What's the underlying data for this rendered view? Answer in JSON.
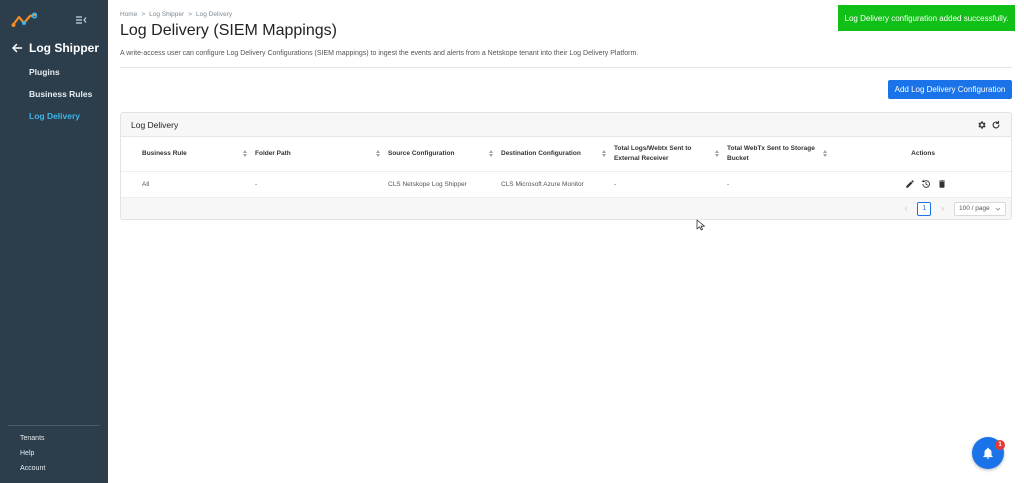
{
  "sidebar": {
    "back_title": "Log Shipper",
    "items": [
      {
        "label": "Plugins",
        "active": false
      },
      {
        "label": "Business Rules",
        "active": false
      },
      {
        "label": "Log Delivery",
        "active": true
      }
    ],
    "footer": [
      {
        "label": "Tenants"
      },
      {
        "label": "Help"
      },
      {
        "label": "Account"
      }
    ]
  },
  "breadcrumb": [
    "Home",
    "Log Shipper",
    "Log Delivery"
  ],
  "breadcrumb_separator": ">",
  "page": {
    "title": "Log Delivery (SIEM Mappings)",
    "description": "A write-access user can configure Log Delivery Configurations (SIEM mappings) to ingest the events and alerts from a Netskope tenant into their Log Delivery Platform."
  },
  "toast": {
    "message": "Log Delivery configuration added successfully."
  },
  "toolbar": {
    "add_label": "Add Log Delivery Configuration"
  },
  "card": {
    "title": "Log Delivery"
  },
  "table": {
    "columns": [
      "Business Rule",
      "Folder Path",
      "Source Configuration",
      "Destination Configuration",
      "Total Logs/Webtx Sent to External Receiver",
      "Total WebTx Sent to Storage Bucket",
      "Actions"
    ],
    "rows": [
      {
        "business_rule": "All",
        "folder_path": "-",
        "source": "CLS Netskope Log Shipper",
        "destination": "CLS Microsoft Azure Monitor",
        "total_logs": "-",
        "total_webtx": "-"
      }
    ]
  },
  "pagination": {
    "current_page": "1",
    "page_size": "100 / page"
  },
  "notifications": {
    "badge_count": "1"
  },
  "colors": {
    "sidebar_bg": "#2c3e4c",
    "accent": "#1a73e8",
    "active_nav": "#3fb5e8",
    "toast_bg": "#11c016"
  }
}
